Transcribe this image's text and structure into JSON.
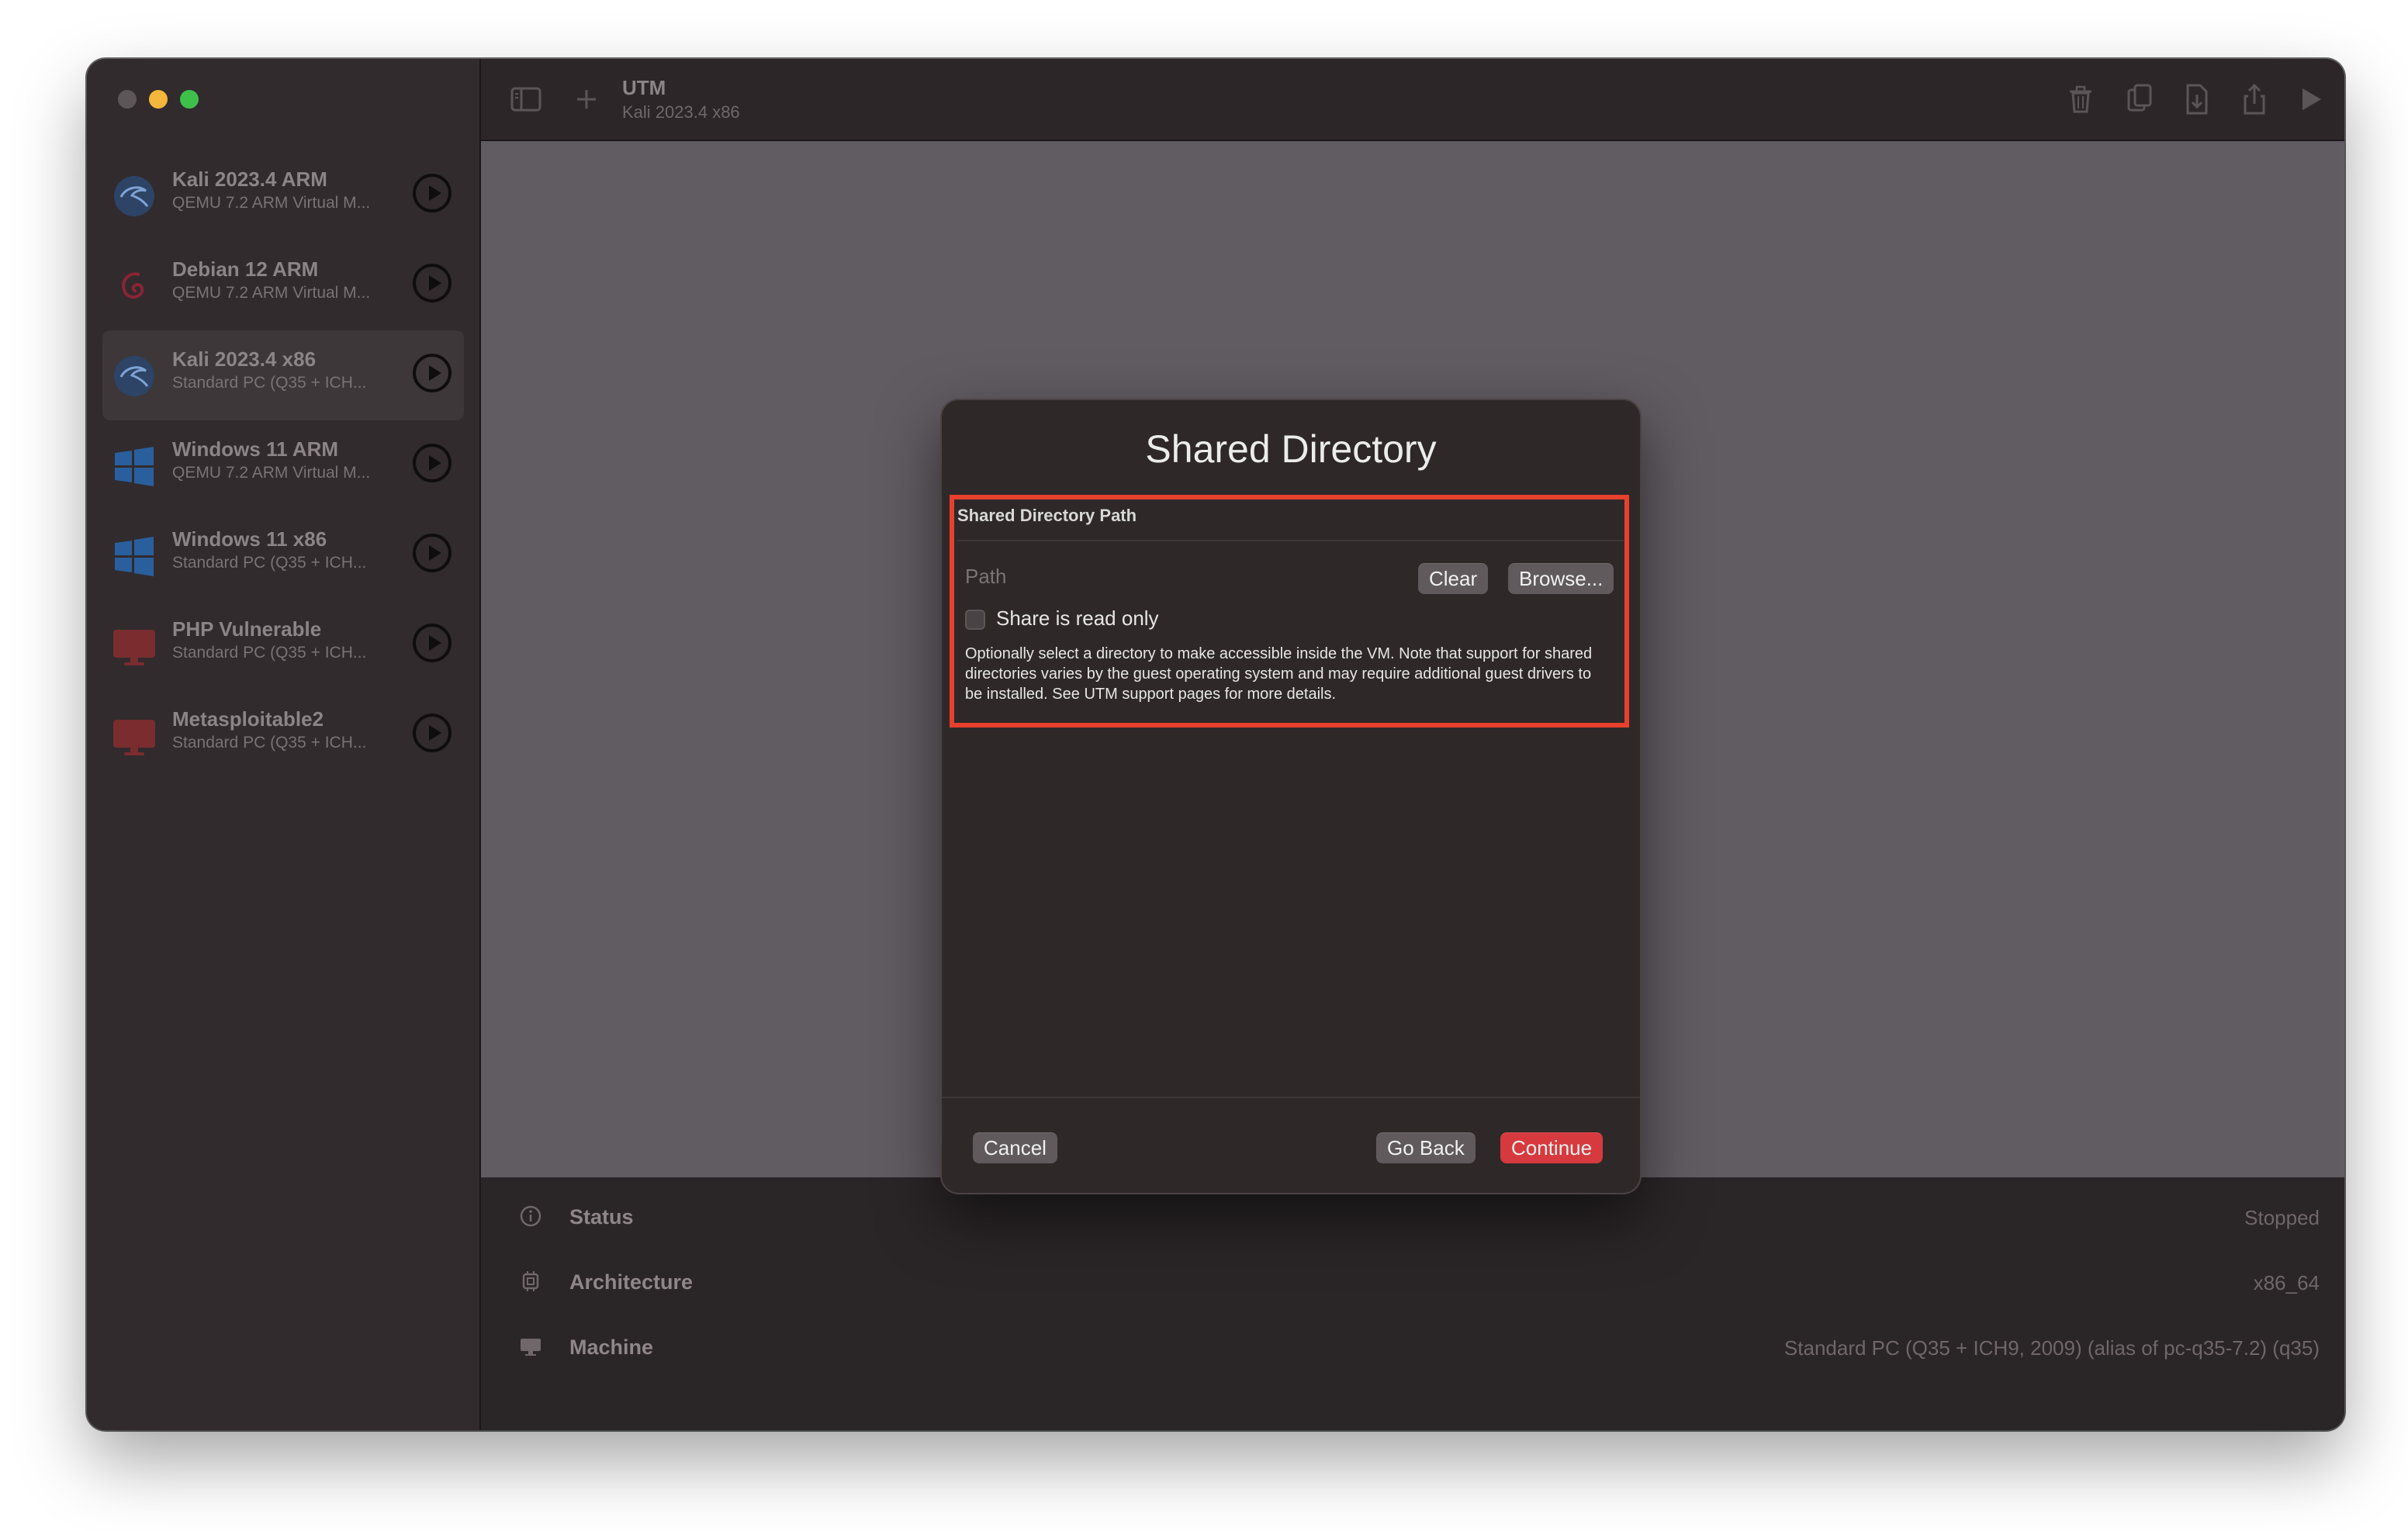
{
  "window": {
    "traffic_lights": [
      "close",
      "minimize",
      "maximize"
    ]
  },
  "sidebar": {
    "items": [
      {
        "name": "Kali 2023.4 ARM",
        "subtitle": "QEMU 7.2 ARM Virtual M...",
        "icon": "kali-dragon-icon",
        "selected": false
      },
      {
        "name": "Debian 12 ARM",
        "subtitle": "QEMU 7.2 ARM Virtual M...",
        "icon": "debian-swirl-icon",
        "selected": false
      },
      {
        "name": "Kali 2023.4 x86",
        "subtitle": "Standard PC (Q35 + ICH...",
        "icon": "kali-dragon-icon",
        "selected": true
      },
      {
        "name": "Windows 11 ARM",
        "subtitle": "QEMU 7.2 ARM Virtual M...",
        "icon": "windows-logo-icon",
        "selected": false
      },
      {
        "name": "Windows 11 x86",
        "subtitle": "Standard PC (Q35 + ICH...",
        "icon": "windows-logo-icon",
        "selected": false
      },
      {
        "name": "PHP Vulnerable",
        "subtitle": "Standard PC (Q35 + ICH...",
        "icon": "monitor-icon",
        "selected": false
      },
      {
        "name": "Metasploitable2",
        "subtitle": "Standard PC (Q35 + ICH...",
        "icon": "monitor-icon",
        "selected": false
      }
    ]
  },
  "toolbar": {
    "title": "UTM",
    "subtitle": "Kali 2023.4 x86",
    "icons": [
      "sidebar-toggle-icon",
      "plus-icon",
      "trash-icon",
      "clone-icon",
      "download-icon",
      "share-icon",
      "play-icon",
      "settings-sliders-icon"
    ]
  },
  "details": [
    {
      "label": "Status",
      "value": "Stopped",
      "icon": "info-circle-icon"
    },
    {
      "label": "Architecture",
      "value": "x86_64",
      "icon": "cpu-chip-icon"
    },
    {
      "label": "Machine",
      "value": "Standard PC (Q35 + ICH9, 2009) (alias of pc-q35-7.2) (q35)",
      "icon": "display-icon"
    }
  ],
  "dialog": {
    "title": "Shared Directory",
    "section_header": "Shared Directory Path",
    "path_placeholder": "Path",
    "clear_label": "Clear",
    "browse_label": "Browse...",
    "readonly_label": "Share is read only",
    "readonly_checked": false,
    "description": "Optionally select a directory to make accessible inside the VM. Note that support for shared directories varies by the guest operating system and may require additional guest drivers to be installed. See UTM support pages for more details.",
    "cancel_label": "Cancel",
    "goback_label": "Go Back",
    "continue_label": "Continue",
    "highlight_color": "#e8402e",
    "accent_color": "#d63a3e"
  }
}
